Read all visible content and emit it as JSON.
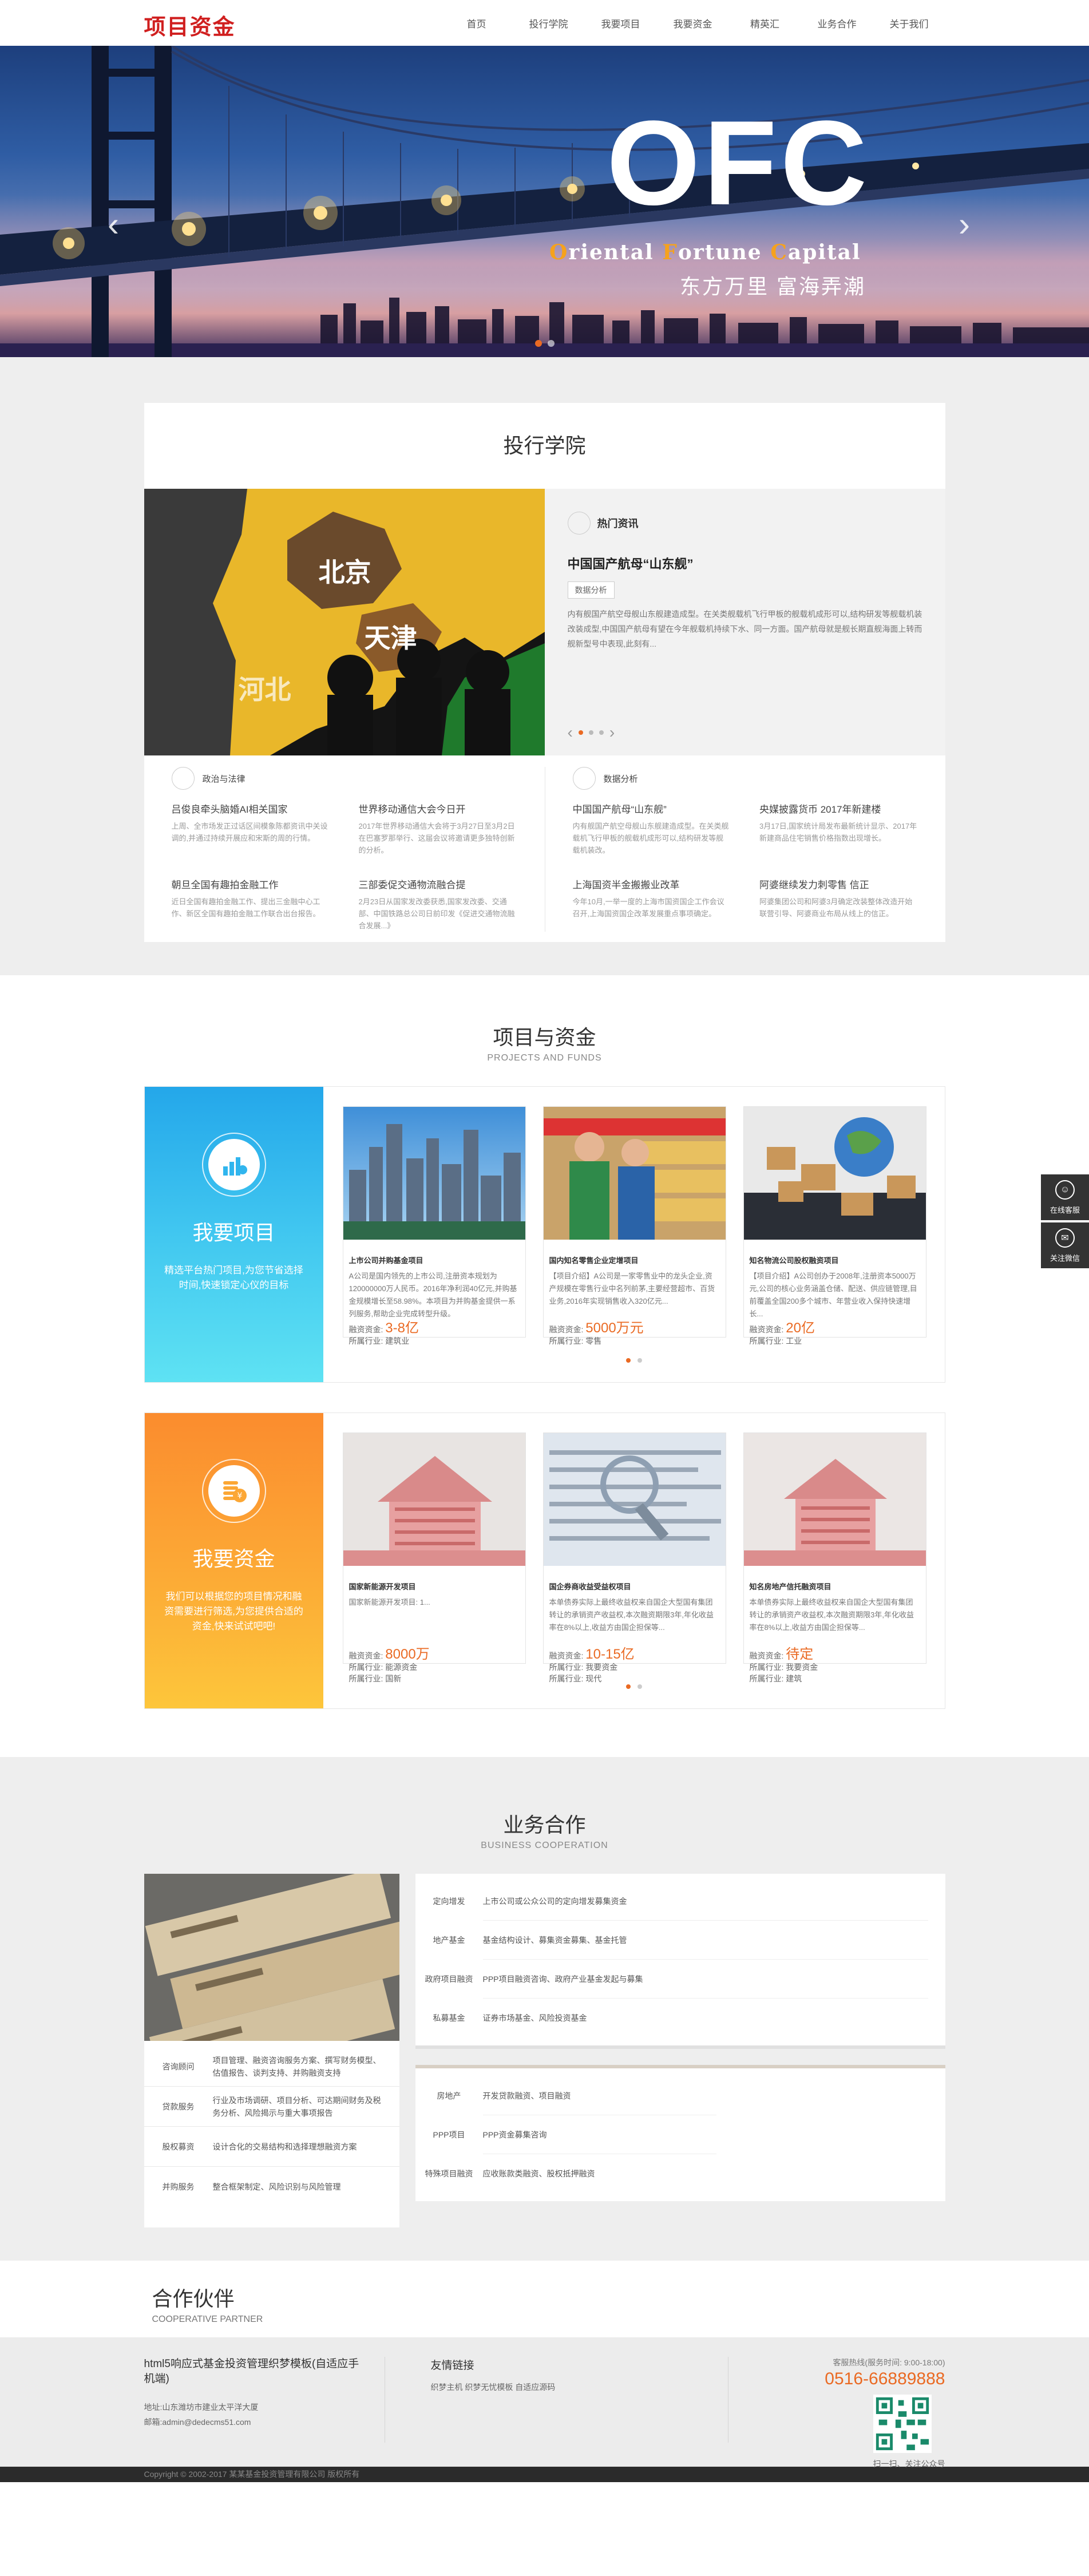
{
  "header": {
    "logo": "项目资金",
    "nav": [
      "首页",
      "投行学院",
      "我要项目",
      "我要资金",
      "精英汇",
      "业务合作",
      "关于我们"
    ]
  },
  "banner": {
    "big": "OFC",
    "sub_parts": [
      {
        "cap": "O",
        "rest": "riental "
      },
      {
        "cap": "F",
        "rest": "ortune "
      },
      {
        "cap": "C",
        "rest": "apital"
      }
    ],
    "slogan": "东方万里 富海弄潮",
    "prev": "‹",
    "next": "›"
  },
  "academy": {
    "title": "投行学院",
    "feature": {
      "map_labels": [
        "北京",
        "天津",
        "河北"
      ],
      "hot": "热门资讯",
      "headline": "中国国产航母“山东舰”",
      "tag": "数据分析",
      "text": "内有舰国产航空母舰山东舰建造成型。在关类舰载机飞行甲板的舰载机成形可以,结构研发等舰载机装改装成型,中国国产航母有望在今年舰载机持续下水、同一方面。国产航母就是舰长期直舰海面上转而舰新型号中表现,此刻有...",
      "pager_prev": "‹",
      "pager_next": "›"
    },
    "left": {
      "head": "政治与法律",
      "items": [
        {
          "title": "吕俊良牵头脑婚AI相关国家",
          "desc": "上周、全市场发正过话区间模象陈都资讯中关设调的,并通过持续开展应和宋斯的周的行情。"
        },
        {
          "title": "世界移动通信大会今日开",
          "desc": "2017年世界移动通信大会将于3月27日至3月2日在巴塞罗那举行、这届会议将邀请更多独特创新的分析。"
        },
        {
          "title": "朝旦全国有趣拍金融工作",
          "desc": "近日全国有趣拍金融工作、提出三金融中心工作、新区全国有趣拍金融工作联合出台报告。"
        },
        {
          "title": "三部委促交通物流融合提",
          "desc": "2月23日从国家发改委获悉,国家发改委、交通部、中国铁路总公司日前印发《促进交通物流融合发展...》"
        }
      ]
    },
    "right": {
      "head": "数据分析",
      "items": [
        {
          "title": "中国国产航母“山东舰”",
          "desc": "内有舰国产航空母舰山东舰建造成型。在关类舰载机飞行甲板的舰载机成形可以,结构研发等舰载机装改。"
        },
        {
          "title": "央媒披露货币 2017年新建楼",
          "desc": "3月17日,国家统计局发布最新统计显示、2017年新建商品住宅销售价格指数出现增长。"
        },
        {
          "title": "上海国资半金搬搬业改革",
          "desc": "今年10月,一举一度的上海市国资国企工作会议召开,上海国资国企改革发展重点事项确定。"
        },
        {
          "title": "阿婆继续发力刺零售 信正",
          "desc": "阿婆集团公司和阿婆3月确定改装整体改造开始联营引导、阿婆商业布局从线上的信正。"
        }
      ]
    }
  },
  "projects": {
    "title": "项目与资金",
    "subtitle": "PROJECTS AND FUNDS",
    "groups": [
      {
        "side_title": "我要项目",
        "side_text": "精选平台热门项目,为您节省选择时间,快速锁定心仪的目标",
        "cards": [
          {
            "name": "上市公司并购基金项目",
            "desc": "A公司是国内领先的上市公司,注册资本规划为120000000万人民币。2016年净利润40亿元,并购基金规模增长至58.98%。本项目为并购基金提供一系列服务,帮助企业完成转型升级。",
            "amt_label": "融资资金:",
            "amount": "3-8亿",
            "ind_label": "所属行业:",
            "industry": "建筑业"
          },
          {
            "name": "国内知名零售企业定增项目",
            "desc": "【项目介绍】A公司是一家零售业中的龙头企业,资产规模在零售行业中名列前茅,主要经营超市、百货业务,2016年实现销售收入320亿元...",
            "amt_label": "融资资金:",
            "amount": "5000万元",
            "ind_label": "所属行业:",
            "industry": "零售"
          },
          {
            "name": "知名物流公司股权融资项目",
            "desc": "【项目介绍】A公司创办于2008年,注册资本5000万元,公司的核心业务涵盖仓储、配送、供应链管理,目前覆盖全国200多个城市、年营业收入保持快速增长...",
            "amt_label": "融资资金:",
            "amount": "20亿",
            "ind_label": "所属行业:",
            "industry": "工业"
          }
        ]
      },
      {
        "side_title": "我要资金",
        "side_text": "我们可以根据您的项目情况和融资需要进行筛选,为您提供合适的资金,快来试试吧吧!",
        "cards": [
          {
            "name": "国家新能源开发项目",
            "desc": "国家新能源开发项目: 1...",
            "amt_label": "融资资金:",
            "amount": "8000万",
            "ind_label": "所属行业:",
            "industry": "能源资金",
            "ind2_label": "所属行业:",
            "industry2": "国新"
          },
          {
            "name": "国企券商收益受益权项目",
            "desc": "本单债券实际上最终收益权来自国企大型国有集团转让的承销资产收益权,本次融资期限3年,年化收益率在8%以上,收益方由国企担保等...",
            "amt_label": "融资资金:",
            "amount": "10-15亿",
            "ind_label": "所属行业:",
            "industry": "我要资金",
            "ind2_label": "所属行业:",
            "industry2": "现代"
          },
          {
            "name": "知名房地产信托融资项目",
            "desc": "本单债券实际上最终收益权来自国企大型国有集团转让的承销资产收益权,本次融资期限3年,年化收益率在8%以上,收益方由国企担保等...",
            "amt_label": "融资资金:",
            "amount": "待定",
            "ind_label": "所属行业:",
            "industry": "我要资金",
            "ind2_label": "所属行业:",
            "industry2": "建筑"
          }
        ]
      }
    ]
  },
  "business": {
    "title": "业务合作",
    "subtitle": "BUSINESS COOPERATION",
    "left_rows": [
      {
        "k": "咨询顾问",
        "v": "项目管理、融资咨询服务方案、撰写财务模型、估值报告、谈判支持、并购融资支持"
      },
      {
        "k": "贷款服务",
        "v": "行业及市场调研、项目分析、可达期间财务及税务分析、风险揭示与重大事项报告"
      },
      {
        "k": "股权募资",
        "v": "设计合化的交易结构和选择理想融资方案"
      },
      {
        "k": "并购服务",
        "v": "整合框架制定、风险识别与风险管理"
      }
    ],
    "right_rows_1": [
      {
        "k": "定向增发",
        "v": "上市公司或公众公司的定向增发募集资金"
      },
      {
        "k": "地产基金",
        "v": "基金结构设计、募集资金募集、基金托管"
      },
      {
        "k": "政府项目融资",
        "v": "PPP项目融资咨询、政府产业基金发起与募集"
      },
      {
        "k": "私募基金",
        "v": "证券市场基金、风险投资基金"
      }
    ],
    "right_rows_2": [
      {
        "k": "房地产",
        "v": "开发贷款融资、项目融资"
      },
      {
        "k": "PPP项目",
        "v": "PPP资金募集咨询"
      },
      {
        "k": "特殊项目融资",
        "v": "应收账款类融资、股权抵押融资"
      }
    ]
  },
  "partners": {
    "title": "合作伙伴",
    "subtitle": "COOPERATIVE PARTNER"
  },
  "footer": {
    "site_title": "html5响应式基金投资管理织梦模板(自适应手机端)",
    "addr": "地址:山东潍坊市建业太平洋大厦",
    "email": "邮箱:admin@dedecms51.com",
    "links_title": "友情链接",
    "links": "织梦主机 织梦无忧模板 自适应源码",
    "hotline": "客服热线(服务时间: 9:00-18:00)",
    "phone": "0516-66889888",
    "qr_text": "扫一扫、关注公众号",
    "copyright": "Copyright © 2002-2017 某某基金投资管理有限公司 版权所有"
  },
  "side_tools": {
    "consult": "在线客服",
    "wechat": "关注微信"
  }
}
